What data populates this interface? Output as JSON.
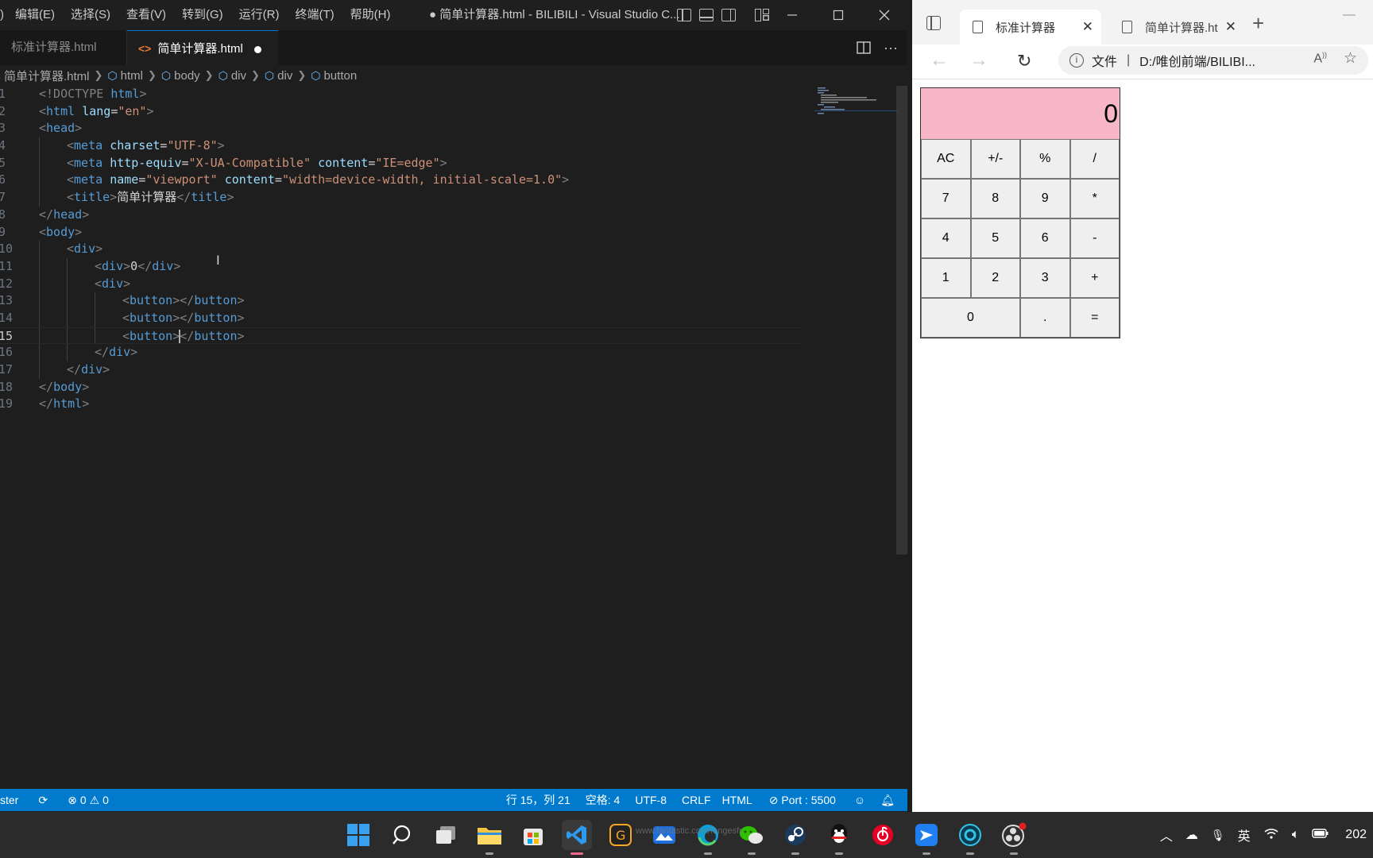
{
  "vscode": {
    "menu": [
      "编辑(E)",
      "选择(S)",
      "查看(V)",
      "转到(G)",
      "运行(R)",
      "终端(T)",
      "帮助(H)"
    ],
    "menu_partial": ")",
    "window_title": "● 简单计算器.html - BILIBILI - Visual Studio C...",
    "tabs": [
      {
        "label": "标准计算器.html",
        "active": false
      },
      {
        "label": "简单计算器.html",
        "active": true,
        "modified": true
      }
    ],
    "breadcrumb": [
      "简单计算器.html",
      "html",
      "body",
      "div",
      "div",
      "button"
    ],
    "lines": [
      {
        "n": "1"
      },
      {
        "n": "2"
      },
      {
        "n": "3"
      },
      {
        "n": "4"
      },
      {
        "n": "5"
      },
      {
        "n": "6"
      },
      {
        "n": "7"
      },
      {
        "n": "8"
      },
      {
        "n": "9"
      },
      {
        "n": "10"
      },
      {
        "n": "11"
      },
      {
        "n": "12"
      },
      {
        "n": "13"
      },
      {
        "n": "14"
      },
      {
        "n": "15"
      },
      {
        "n": "16"
      },
      {
        "n": "17"
      },
      {
        "n": "18"
      },
      {
        "n": "19"
      }
    ],
    "code": {
      "doctype": "<!DOCTYPE",
      "doctype_name": "html",
      "lang_value": "\"en\"",
      "charset_value": "\"UTF-8\"",
      "httpequiv_value": "\"X-UA-Compatible\"",
      "content_value": "\"IE=edge\"",
      "viewport_value": "\"viewport\"",
      "viewport_content": "\"width=device-width, initial-scale=1.0\"",
      "title_text": "简单计算器",
      "div_text": "0"
    },
    "status": {
      "branch": "ster",
      "errors": "0",
      "warnings": "0",
      "position": "行 15，列 21",
      "spaces": "空格: 4",
      "encoding": "UTF-8",
      "eol": "CRLF",
      "language": "HTML",
      "port": "Port : 5500"
    },
    "accent_color": "#007acc"
  },
  "browser": {
    "tabs": [
      {
        "label": "标准计算器",
        "active": true
      },
      {
        "label": "简单计算器.ht",
        "active": false
      }
    ],
    "address_label": "文件",
    "address_url": "D:/唯创前端/BILIBI...",
    "calculator": {
      "display": "0",
      "display_color": "#f7b6c8",
      "keys": [
        "AC",
        "+/-",
        "%",
        "/",
        "7",
        "8",
        "9",
        "*",
        "4",
        "5",
        "6",
        "-",
        "1",
        "2",
        "3",
        "+",
        "0",
        ".",
        "="
      ]
    }
  },
  "taskbar": {
    "apps": [
      "windows-start",
      "search",
      "task-view",
      "file-explorer",
      "microsoft-store",
      "vscode",
      "app-g",
      "app-photos",
      "edge",
      "wechat",
      "steam",
      "qq",
      "netease-music",
      "app-feishu",
      "app-circle",
      "obs"
    ],
    "watermark": "www.fantastic.com/fangesfn",
    "tray": {
      "ime": "英",
      "clock": "202"
    }
  }
}
